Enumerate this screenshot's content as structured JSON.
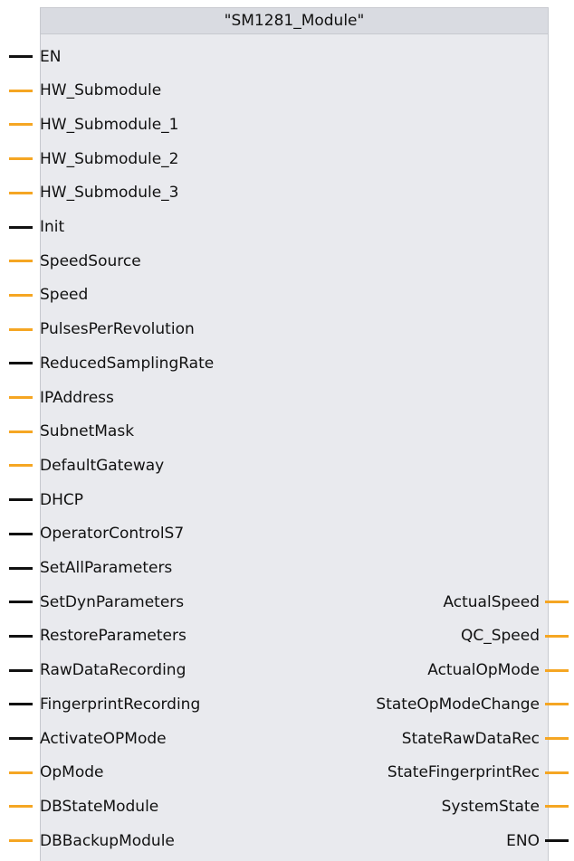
{
  "block": {
    "title": "\"SM1281_Module\""
  },
  "colors": {
    "bool_pin": "#111111",
    "other_pin": "#f5a623",
    "block_bg": "#e9eaee",
    "header_bg": "#d9dbe1"
  },
  "inputs": [
    {
      "label": "EN",
      "type": "bool"
    },
    {
      "label": "HW_Submodule",
      "type": "other"
    },
    {
      "label": "HW_Submodule_1",
      "type": "other"
    },
    {
      "label": "HW_Submodule_2",
      "type": "other"
    },
    {
      "label": "HW_Submodule_3",
      "type": "other"
    },
    {
      "label": "Init",
      "type": "bool"
    },
    {
      "label": "SpeedSource",
      "type": "other"
    },
    {
      "label": "Speed",
      "type": "other"
    },
    {
      "label": "PulsesPerRevolution",
      "type": "other"
    },
    {
      "label": "ReducedSamplingRate",
      "type": "bool"
    },
    {
      "label": "IPAddress",
      "type": "other"
    },
    {
      "label": "SubnetMask",
      "type": "other"
    },
    {
      "label": "DefaultGateway",
      "type": "other"
    },
    {
      "label": "DHCP",
      "type": "bool"
    },
    {
      "label": "OperatorControlS7",
      "type": "bool"
    },
    {
      "label": "SetAllParameters",
      "type": "bool"
    },
    {
      "label": "SetDynParameters",
      "type": "bool"
    },
    {
      "label": "RestoreParameters",
      "type": "bool"
    },
    {
      "label": "RawDataRecording",
      "type": "bool"
    },
    {
      "label": "FingerprintRecording",
      "type": "bool"
    },
    {
      "label": "ActivateOPMode",
      "type": "bool"
    },
    {
      "label": "OpMode",
      "type": "other"
    },
    {
      "label": "DBStateModule",
      "type": "other"
    },
    {
      "label": "DBBackupModule",
      "type": "other"
    }
  ],
  "outputs": [
    {
      "label": "ActualSpeed",
      "type": "other"
    },
    {
      "label": "QC_Speed",
      "type": "other"
    },
    {
      "label": "ActualOpMode",
      "type": "other"
    },
    {
      "label": "StateOpModeChange",
      "type": "other"
    },
    {
      "label": "StateRawDataRec",
      "type": "other"
    },
    {
      "label": "StateFingerprintRec",
      "type": "other"
    },
    {
      "label": "SystemState",
      "type": "other"
    },
    {
      "label": "ENO",
      "type": "bool"
    }
  ]
}
